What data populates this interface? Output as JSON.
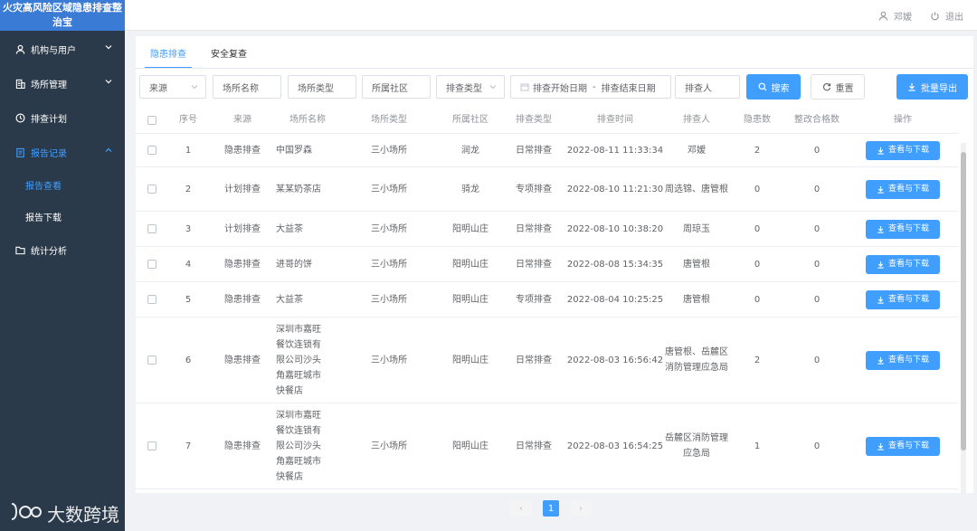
{
  "app": {
    "title": "火灾高风险区域隐患排查整治宝"
  },
  "sidebar": {
    "items": [
      {
        "label": "机构与用户",
        "icon": "user-icon",
        "has_arrow": true
      },
      {
        "label": "场所管理",
        "icon": "building-icon",
        "has_arrow": true
      },
      {
        "label": "排查计划",
        "icon": "clock-icon",
        "has_arrow": false
      },
      {
        "label": "报告记录",
        "icon": "report-icon",
        "has_arrow": true,
        "expanded": true
      },
      {
        "label": "统计分析",
        "icon": "folder-icon",
        "has_arrow": false
      }
    ],
    "sub_items": [
      {
        "label": "报告查看",
        "active": true
      },
      {
        "label": "报告下载",
        "active": false
      }
    ]
  },
  "header": {
    "user_name": "邓嫒",
    "logout_label": "退出"
  },
  "tabs": [
    {
      "label": "隐患排查",
      "active": true
    },
    {
      "label": "安全复查",
      "active": false
    }
  ],
  "filters": {
    "source_placeholder": "来源",
    "place_name_placeholder": "场所名称",
    "place_type_placeholder": "场所类型",
    "community_placeholder": "所属社区",
    "check_type_placeholder": "排查类型",
    "start_date_placeholder": "排查开始日期",
    "date_separator": "-",
    "end_date_placeholder": "排查结束日期",
    "inspector_placeholder": "排查人"
  },
  "buttons": {
    "search": "搜索",
    "reset": "重置",
    "export": "批量导出"
  },
  "table": {
    "columns": [
      "序号",
      "来源",
      "场所名称",
      "场所类型",
      "所属社区",
      "排查类型",
      "排查时间",
      "排查人",
      "隐患数",
      "整改合格数",
      "操作"
    ],
    "action_label": "查看与下载",
    "rows": [
      {
        "no": "1",
        "source": "隐患排查",
        "name": "中国罗森",
        "type": "三小场所",
        "community": "润龙",
        "check_type": "日常排查",
        "time": "2022-08-11 11:33:34",
        "inspector": "邓嫒",
        "hazards": "2",
        "fixed": "0"
      },
      {
        "no": "2",
        "source": "计划排查",
        "name": "某某奶茶店",
        "type": "三小场所",
        "community": "骑龙",
        "check_type": "专项排查",
        "time": "2022-08-10 11:21:30",
        "inspector": "周选锦、唐管根",
        "hazards": "0",
        "fixed": "0"
      },
      {
        "no": "3",
        "source": "计划排查",
        "name": "大益茶",
        "type": "三小场所",
        "community": "阳明山庄",
        "check_type": "日常排查",
        "time": "2022-08-10 10:38:20",
        "inspector": "周琼玉",
        "hazards": "0",
        "fixed": "0"
      },
      {
        "no": "4",
        "source": "隐患排查",
        "name": "进哥的饼",
        "type": "三小场所",
        "community": "阳明山庄",
        "check_type": "日常排查",
        "time": "2022-08-08 15:34:35",
        "inspector": "唐管根",
        "hazards": "0",
        "fixed": "0"
      },
      {
        "no": "5",
        "source": "隐患排查",
        "name": "大益茶",
        "type": "三小场所",
        "community": "阳明山庄",
        "check_type": "专项排查",
        "time": "2022-08-04 10:25:25",
        "inspector": "唐管根",
        "hazards": "0",
        "fixed": "0"
      },
      {
        "no": "6",
        "source": "隐患排查",
        "name": "深圳市嘉旺餐饮连锁有限公司沙头角嘉旺城市快餐店",
        "type": "三小场所",
        "community": "阳明山庄",
        "check_type": "日常排查",
        "time": "2022-08-03 16:56:42",
        "inspector": "唐管根、岳麓区消防管理应急局",
        "hazards": "2",
        "fixed": "0"
      },
      {
        "no": "7",
        "source": "隐患排查",
        "name": "深圳市嘉旺餐饮连锁有限公司沙头角嘉旺城市快餐店",
        "type": "三小场所",
        "community": "阳明山庄",
        "check_type": "日常排查",
        "time": "2022-08-03 16:54:25",
        "inspector": "岳麓区消防管理应急局",
        "hazards": "1",
        "fixed": "0"
      }
    ]
  },
  "pagination": {
    "current_page": "1",
    "prev_label": "‹",
    "next_label": "›"
  },
  "watermark": {
    "text": "大数跨境"
  },
  "colors": {
    "sidebar_bg": "#2b3a4a",
    "logo_bg": "#3a7bd5",
    "primary": "#409eff"
  }
}
